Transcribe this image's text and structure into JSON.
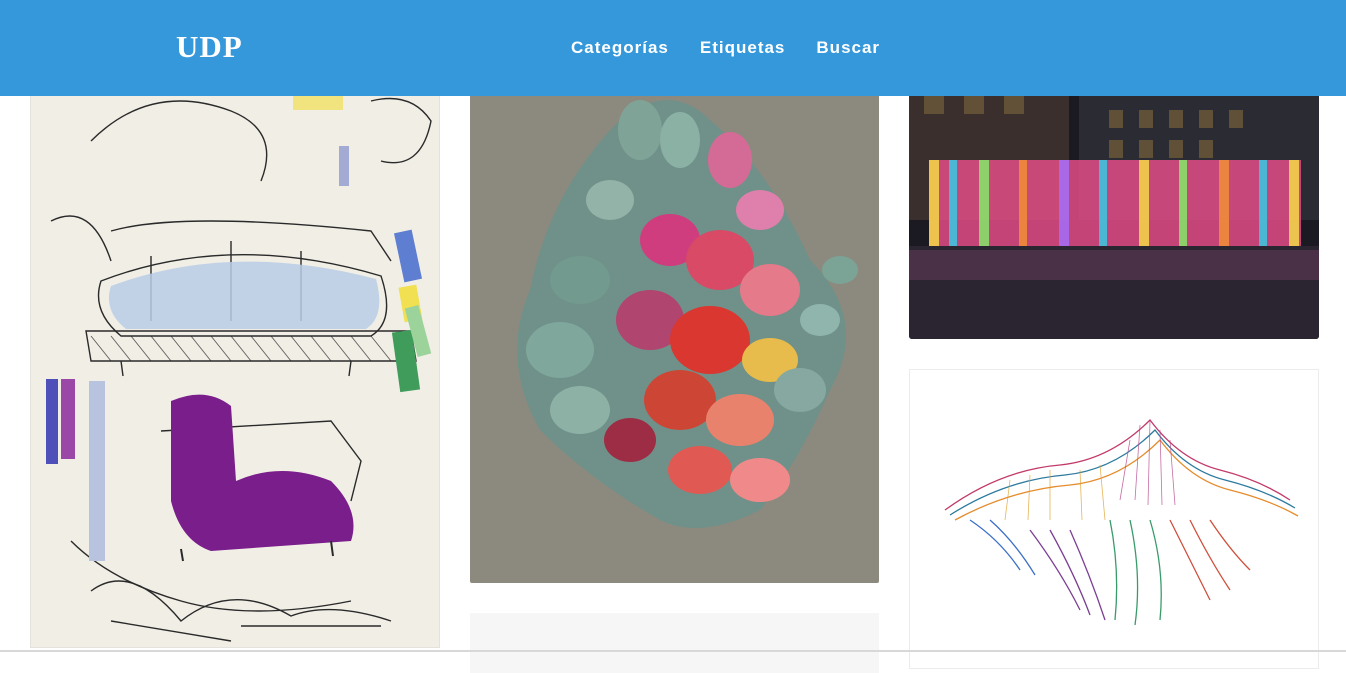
{
  "header": {
    "brand": "UDP",
    "nav": [
      {
        "label": "Categorías"
      },
      {
        "label": "Etiquetas"
      },
      {
        "label": "Buscar"
      }
    ],
    "background_color": "#3598db",
    "text_color": "#ffffff"
  },
  "feed": {
    "cards": [
      {
        "type": "image",
        "subject": "sofa-and-armchair-design-sketch"
      },
      {
        "type": "image",
        "subject": "textile-pebble-sculpture"
      },
      {
        "type": "image",
        "subject": "night-light-installation"
      },
      {
        "type": "image",
        "subject": "partially-visible-card"
      },
      {
        "type": "image",
        "subject": "colorful-line-mountain-drawing"
      }
    ]
  }
}
